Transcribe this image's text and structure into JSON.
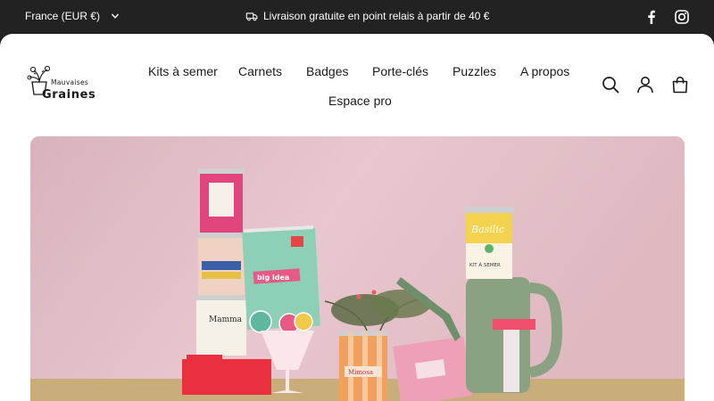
{
  "topbar": {
    "locale_label": "France (EUR €)",
    "locale_icon": "chevron-down-icon",
    "announcement_icon": "truck-icon",
    "announcement": "Livraison gratuite en point relais à partir de 40 €",
    "social": [
      {
        "name": "facebook",
        "icon": "facebook-icon"
      },
      {
        "name": "instagram",
        "icon": "instagram-icon"
      }
    ]
  },
  "brand": {
    "line1": "Mauvaises",
    "line2": "Graines"
  },
  "nav": {
    "items": [
      {
        "label": "Kits à semer"
      },
      {
        "label": "Carnets"
      },
      {
        "label": "Badges"
      },
      {
        "label": "Porte-clés"
      },
      {
        "label": "Puzzles"
      },
      {
        "label": "A propos"
      },
      {
        "label": "Espace pro"
      }
    ]
  },
  "header_icons": [
    "search-icon",
    "account-icon",
    "cart-icon"
  ],
  "hero": {
    "image": "product-lineup-photo",
    "tin_labels": {
      "notebook": "big idea",
      "tin_right": "Basilic",
      "tin_right_sub": "KIT À SEMER",
      "tin_left_bottom": "Mamma",
      "tin_front": "Mimosa"
    }
  },
  "colors": {
    "topbar_bg": "#222222",
    "page_bg": "#ffffff",
    "hero_wall": "#e3bfc6",
    "hero_table": "#c9ae7c",
    "text": "#1a1a1a"
  }
}
